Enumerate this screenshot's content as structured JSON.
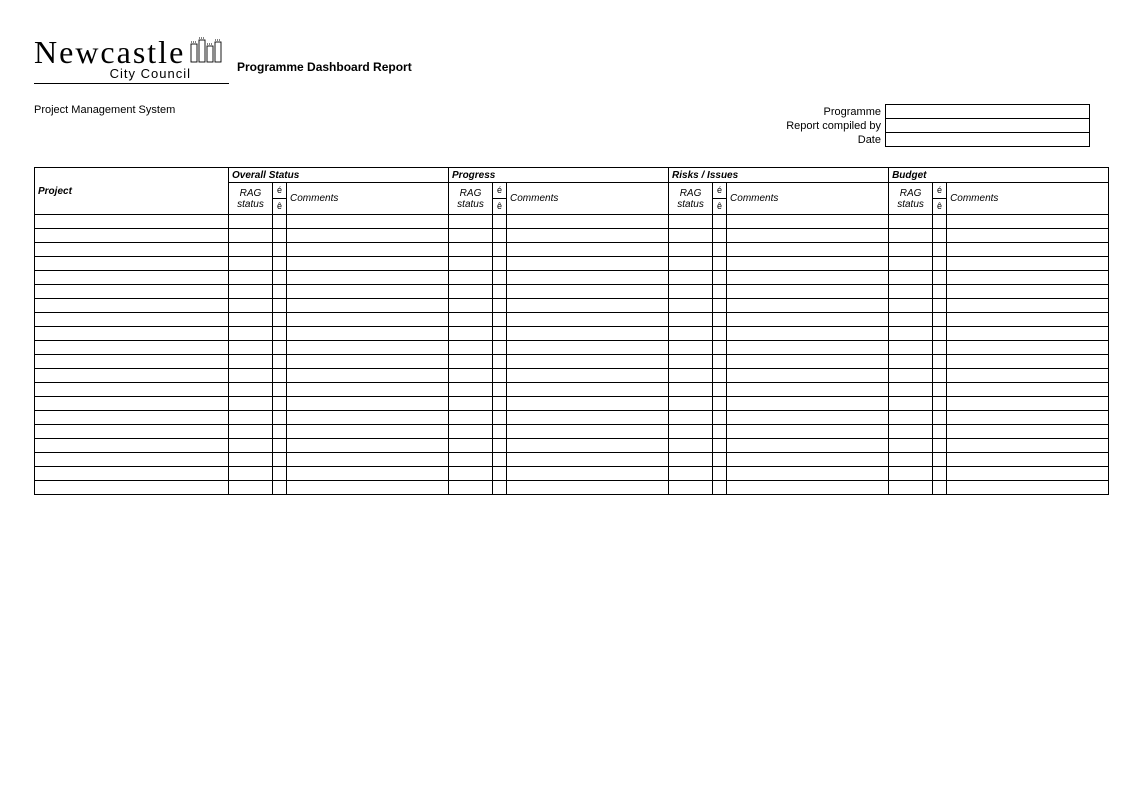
{
  "logo": {
    "name": "Newcastle",
    "sub": "City Council"
  },
  "header": {
    "report_title": "Programme Dashboard Report",
    "system_name": "Project Management System"
  },
  "meta": {
    "programme_label": "Programme",
    "programme_value": "",
    "compiled_label": "Report compiled by",
    "compiled_value": "",
    "date_label": "Date",
    "date_value": ""
  },
  "table": {
    "project_header": "Project",
    "groups": {
      "overall": "Overall Status",
      "progress": "Progress",
      "risks": "Risks / Issues",
      "budget": "Budget"
    },
    "sub": {
      "rag": "RAG status",
      "comments": "Comments",
      "arrow_up": "é",
      "arrow_down": "ê"
    },
    "row_count": 20
  }
}
